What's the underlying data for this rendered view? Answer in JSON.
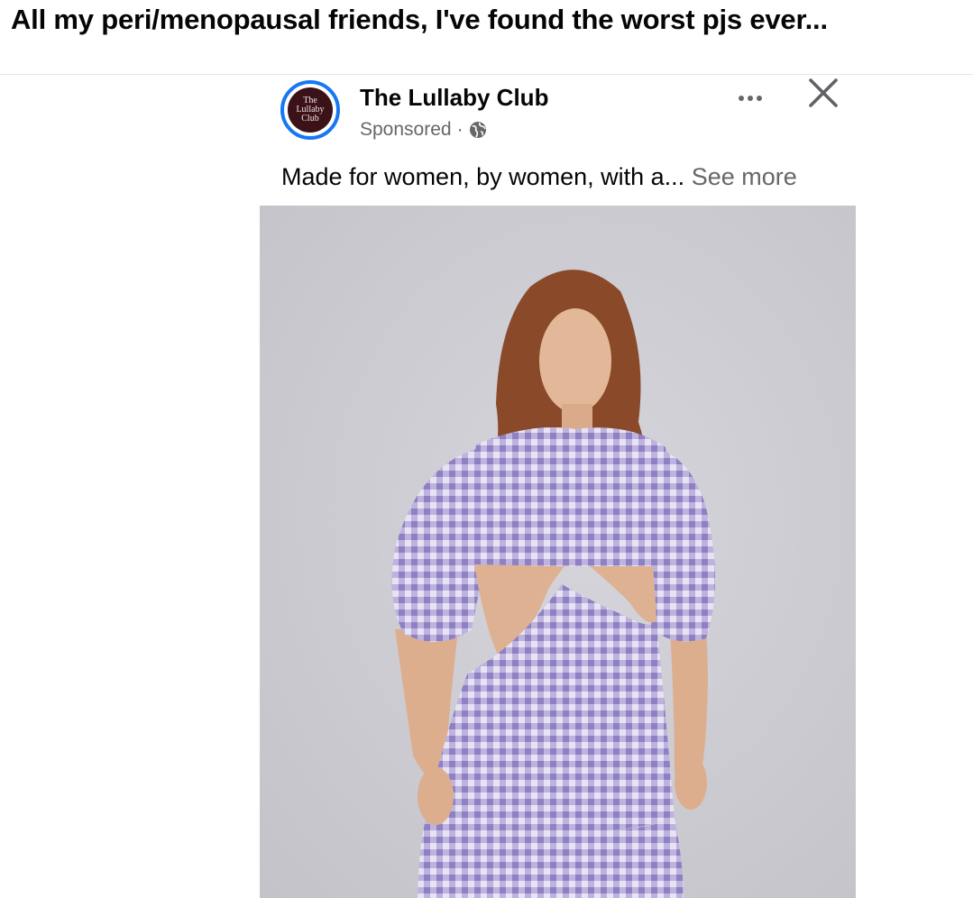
{
  "caption": "All my peri/menopausal friends, I've found the worst pjs ever...",
  "post": {
    "page_name": "The Lullaby Club",
    "avatar_text": [
      "The",
      "Lullaby",
      "Club"
    ],
    "sponsored": "Sponsored",
    "separator": "·",
    "audience_icon": "globe-icon",
    "more_icon": "more-options-icon",
    "close_icon": "close-icon",
    "text": "Made for women, by women, with a...",
    "see_more": "See more",
    "image": {
      "description_icon": "product-photo",
      "colors": {
        "background": "#c9c8cf",
        "gingham_light": "#e6e1f0",
        "gingham_dark": "#9d8fc8",
        "hair": "#8a4a2a",
        "skin": "#e0b595"
      }
    }
  },
  "colors": {
    "accent": "#1877f2",
    "text": "#050505",
    "secondary": "#65676b"
  }
}
